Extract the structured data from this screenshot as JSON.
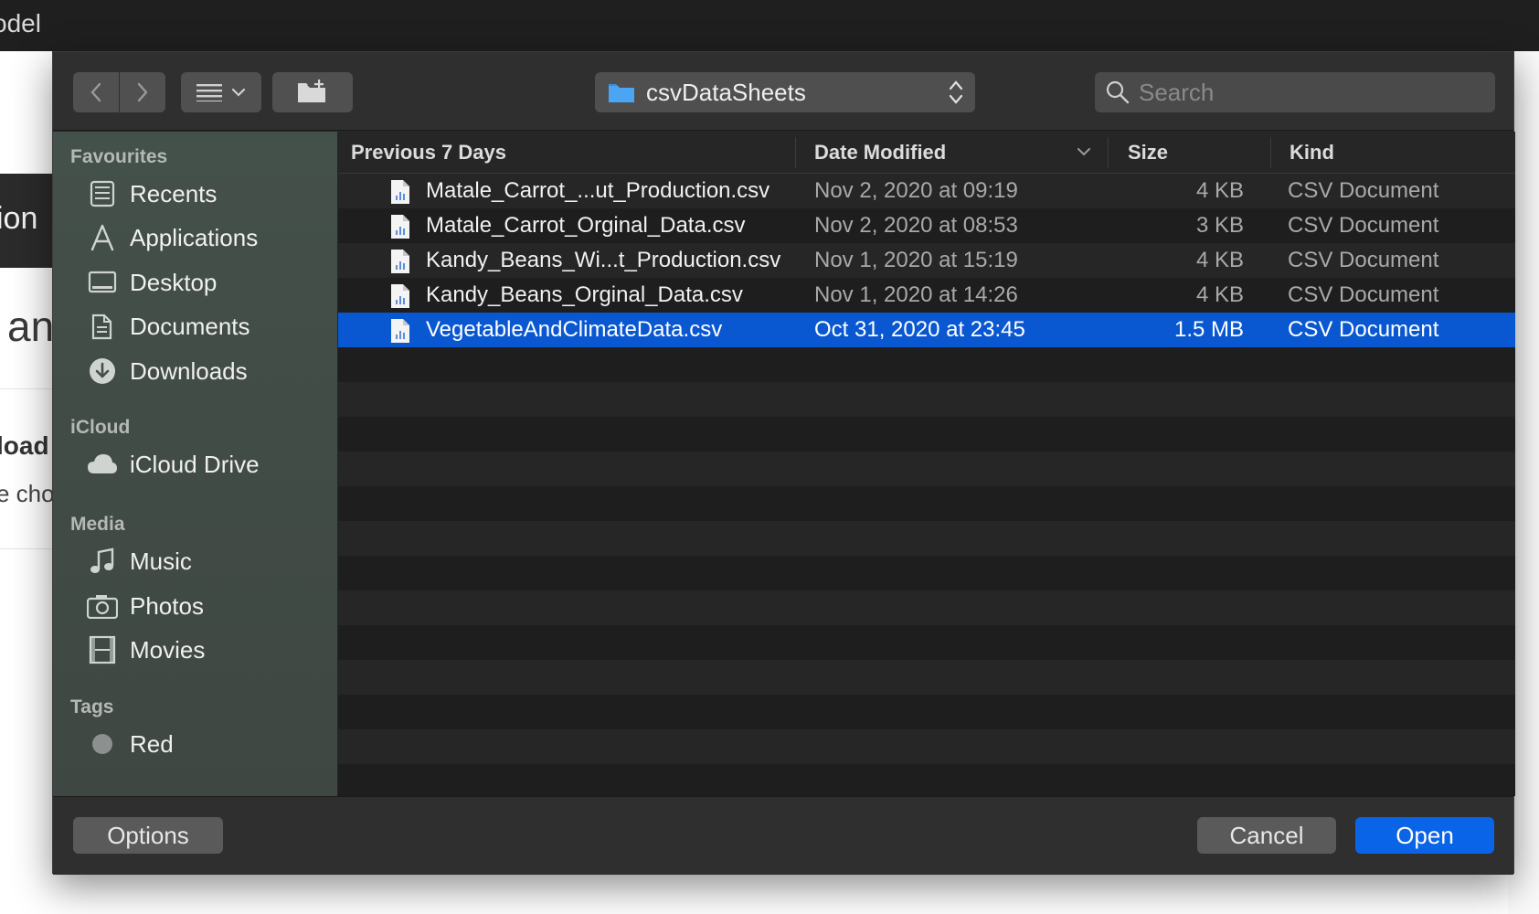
{
  "background": {
    "title_fragment": "odel",
    "band_text": "ion",
    "large_text": "an",
    "bold_text": "load",
    "small_text": "e cho"
  },
  "toolbar": {
    "location": "csvDataSheets",
    "search_placeholder": "Search"
  },
  "sidebar": {
    "sections": [
      {
        "title": "Favourites",
        "items": [
          {
            "label": "Recents",
            "icon": "recents-icon"
          },
          {
            "label": "Applications",
            "icon": "applications-icon"
          },
          {
            "label": "Desktop",
            "icon": "desktop-icon"
          },
          {
            "label": "Documents",
            "icon": "documents-icon"
          },
          {
            "label": "Downloads",
            "icon": "downloads-icon"
          }
        ]
      },
      {
        "title": "iCloud",
        "items": [
          {
            "label": "iCloud Drive",
            "icon": "icloud-icon"
          }
        ]
      },
      {
        "title": "Media",
        "items": [
          {
            "label": "Music",
            "icon": "music-icon"
          },
          {
            "label": "Photos",
            "icon": "photos-icon"
          },
          {
            "label": "Movies",
            "icon": "movies-icon"
          }
        ]
      },
      {
        "title": "Tags",
        "items": [
          {
            "label": "Red",
            "icon": "tag-dot-icon"
          }
        ]
      }
    ]
  },
  "filelist": {
    "columns": {
      "name": "Previous 7 Days",
      "date": "Date Modified",
      "size": "Size",
      "kind": "Kind"
    },
    "files": [
      {
        "name": "Matale_Carrot_...ut_Production.csv",
        "date": "Nov 2, 2020 at 09:19",
        "size": "4 KB",
        "kind": "CSV Document"
      },
      {
        "name": "Matale_Carrot_Orginal_Data.csv",
        "date": "Nov 2, 2020 at 08:53",
        "size": "3 KB",
        "kind": "CSV Document"
      },
      {
        "name": "Kandy_Beans_Wi...t_Production.csv",
        "date": "Nov 1, 2020 at 15:19",
        "size": "4 KB",
        "kind": "CSV Document"
      },
      {
        "name": "Kandy_Beans_Orginal_Data.csv",
        "date": "Nov 1, 2020 at 14:26",
        "size": "4 KB",
        "kind": "CSV Document"
      },
      {
        "name": "VegetableAndClimateData.csv",
        "date": "Oct 31, 2020 at 23:45",
        "size": "1.5 MB",
        "kind": "CSV Document"
      }
    ],
    "selected_file": "VegetableAndClimateData.csv"
  },
  "buttons": {
    "options": "Options",
    "cancel": "Cancel",
    "open": "Open"
  },
  "colors": {
    "selection": "#0a58d1",
    "primary_button": "#0a64e8",
    "sidebar": "#44504a"
  }
}
